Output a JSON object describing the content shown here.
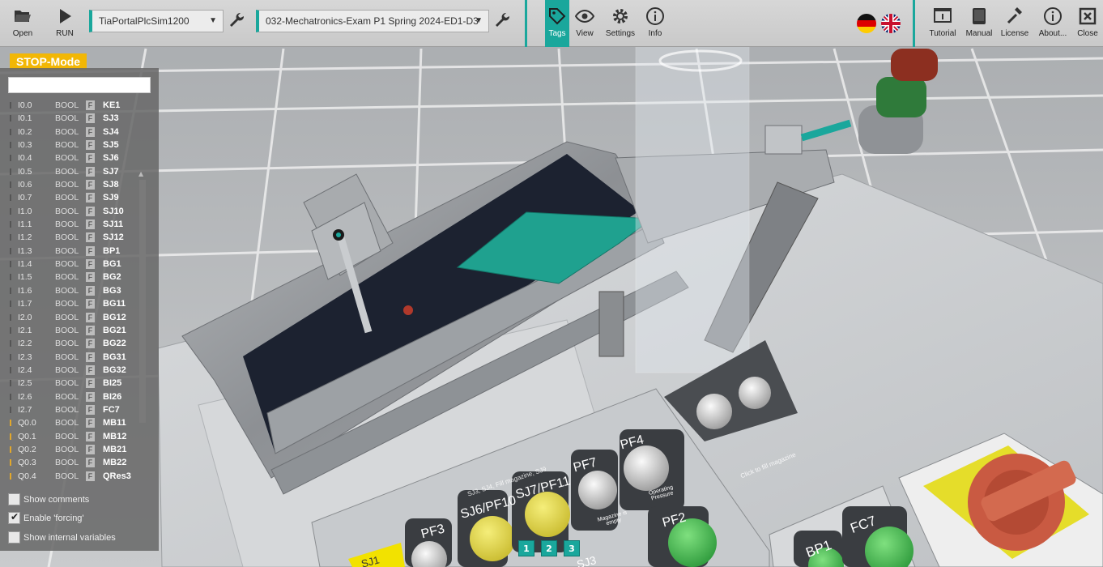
{
  "toolbar": {
    "open_label": "Open",
    "run_label": "RUN",
    "plc_select": "TiaPortalPlcSim1200",
    "project_select": "032-Mechatronics-Exam P1 Spring 2024-ED1-D3",
    "tags_label": "Tags",
    "view_label": "View",
    "settings_label": "Settings",
    "info_label": "Info",
    "tutorial_label": "Tutorial",
    "manual_label": "Manual",
    "license_label": "License",
    "about_label": "About...",
    "close_label": "Close",
    "accent_color": "#1aa79c"
  },
  "status": {
    "mode": "STOP-Mode",
    "mode_color": "#f2b705"
  },
  "tags_panel": {
    "filter_value": "",
    "rows": [
      {
        "addr": "I0.0",
        "type": "BOOL",
        "force": "F",
        "name": "KE1",
        "dir": "in"
      },
      {
        "addr": "I0.1",
        "type": "BOOL",
        "force": "F",
        "name": "SJ3",
        "dir": "in"
      },
      {
        "addr": "I0.2",
        "type": "BOOL",
        "force": "F",
        "name": "SJ4",
        "dir": "in"
      },
      {
        "addr": "I0.3",
        "type": "BOOL",
        "force": "F",
        "name": "SJ5",
        "dir": "in"
      },
      {
        "addr": "I0.4",
        "type": "BOOL",
        "force": "F",
        "name": "SJ6",
        "dir": "in"
      },
      {
        "addr": "I0.5",
        "type": "BOOL",
        "force": "F",
        "name": "SJ7",
        "dir": "in"
      },
      {
        "addr": "I0.6",
        "type": "BOOL",
        "force": "F",
        "name": "SJ8",
        "dir": "in"
      },
      {
        "addr": "I0.7",
        "type": "BOOL",
        "force": "F",
        "name": "SJ9",
        "dir": "in"
      },
      {
        "addr": "I1.0",
        "type": "BOOL",
        "force": "F",
        "name": "SJ10",
        "dir": "in"
      },
      {
        "addr": "I1.1",
        "type": "BOOL",
        "force": "F",
        "name": "SJ11",
        "dir": "in"
      },
      {
        "addr": "I1.2",
        "type": "BOOL",
        "force": "F",
        "name": "SJ12",
        "dir": "in"
      },
      {
        "addr": "I1.3",
        "type": "BOOL",
        "force": "F",
        "name": "BP1",
        "dir": "in"
      },
      {
        "addr": "I1.4",
        "type": "BOOL",
        "force": "F",
        "name": "BG1",
        "dir": "in"
      },
      {
        "addr": "I1.5",
        "type": "BOOL",
        "force": "F",
        "name": "BG2",
        "dir": "in"
      },
      {
        "addr": "I1.6",
        "type": "BOOL",
        "force": "F",
        "name": "BG3",
        "dir": "in"
      },
      {
        "addr": "I1.7",
        "type": "BOOL",
        "force": "F",
        "name": "BG11",
        "dir": "in"
      },
      {
        "addr": "I2.0",
        "type": "BOOL",
        "force": "F",
        "name": "BG12",
        "dir": "in"
      },
      {
        "addr": "I2.1",
        "type": "BOOL",
        "force": "F",
        "name": "BG21",
        "dir": "in"
      },
      {
        "addr": "I2.2",
        "type": "BOOL",
        "force": "F",
        "name": "BG22",
        "dir": "in"
      },
      {
        "addr": "I2.3",
        "type": "BOOL",
        "force": "F",
        "name": "BG31",
        "dir": "in"
      },
      {
        "addr": "I2.4",
        "type": "BOOL",
        "force": "F",
        "name": "BG32",
        "dir": "in"
      },
      {
        "addr": "I2.5",
        "type": "BOOL",
        "force": "F",
        "name": "BI25",
        "dir": "in"
      },
      {
        "addr": "I2.6",
        "type": "BOOL",
        "force": "F",
        "name": "BI26",
        "dir": "in"
      },
      {
        "addr": "I2.7",
        "type": "BOOL",
        "force": "F",
        "name": "FC7",
        "dir": "in"
      },
      {
        "addr": "Q0.0",
        "type": "BOOL",
        "force": "F",
        "name": "MB11",
        "dir": "out"
      },
      {
        "addr": "Q0.1",
        "type": "BOOL",
        "force": "F",
        "name": "MB12",
        "dir": "out"
      },
      {
        "addr": "Q0.2",
        "type": "BOOL",
        "force": "F",
        "name": "MB21",
        "dir": "out"
      },
      {
        "addr": "Q0.3",
        "type": "BOOL",
        "force": "F",
        "name": "MB22",
        "dir": "out"
      },
      {
        "addr": "Q0.4",
        "type": "BOOL",
        "force": "F",
        "name": "QRes3",
        "dir": "out"
      }
    ],
    "show_comments_label": "Show comments",
    "enable_forcing_label": "Enable 'forcing'",
    "show_internal_label": "Show internal variables"
  },
  "scene": {
    "panel_caption": "SJ3, SJ4, Fill magazine, SJ9",
    "click_fill": "Click to fill magazine",
    "pf3": "PF3",
    "sj6_pf10": "SJ6/PF10",
    "sj7_pf11": "SJ7/PF11",
    "pf7": "PF7",
    "pf4": "PF4",
    "pf2": "PF2",
    "bp1": "BP1",
    "fc7": "FC7",
    "sj1": "SJ1",
    "sj3_bottom": "SJ3",
    "magazine_empty": "Magazine is empty",
    "operating_pressure": "Operating Pressure",
    "num1": "1",
    "num2": "2",
    "num3": "3"
  }
}
